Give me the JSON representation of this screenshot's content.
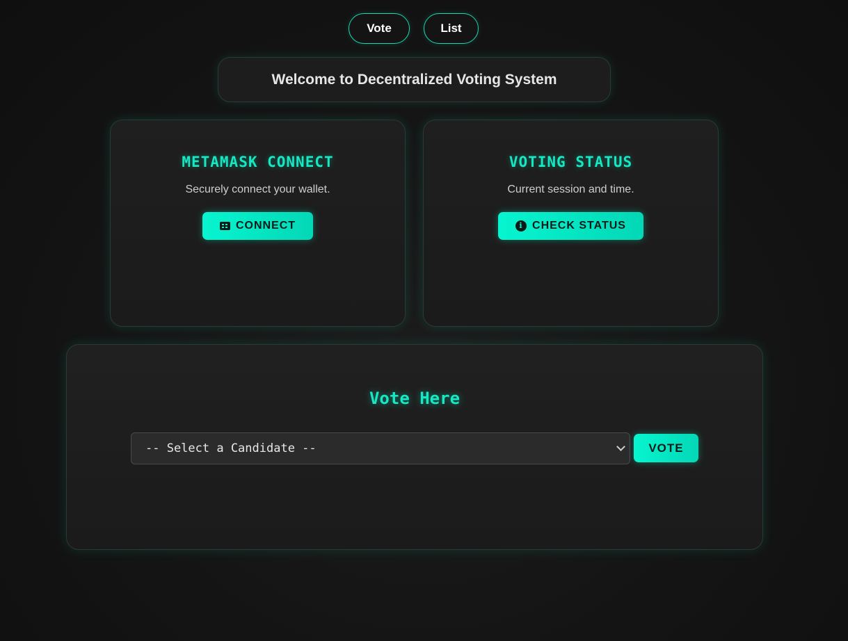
{
  "nav": {
    "vote_label": "Vote",
    "list_label": "List"
  },
  "header": {
    "welcome": "Welcome to Decentralized Voting System"
  },
  "cards": {
    "metamask": {
      "title": "METAMASK CONNECT",
      "description": "Securely connect your wallet.",
      "button_label": "CONNECT",
      "button_icon": "wallet-card-icon"
    },
    "status": {
      "title": "VOTING STATUS",
      "description": "Current session and time.",
      "button_label": "CHECK STATUS",
      "button_icon": "info-icon"
    }
  },
  "vote_panel": {
    "title": "Vote Here",
    "select_value": "-- Select a Candidate --",
    "vote_button_label": "VOTE"
  },
  "colors": {
    "accent": "#07f5d0",
    "background": "#141414",
    "panel": "#1d1d1d"
  }
}
